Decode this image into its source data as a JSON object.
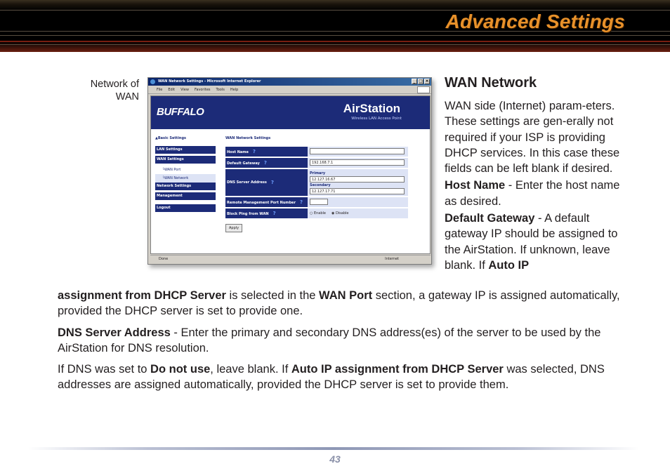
{
  "header": {
    "title": "Advanced Settings"
  },
  "figure": {
    "caption": "Network of WAN",
    "window_title": "WAN Network Settings - Microsoft Internet Explorer",
    "menu": [
      "File",
      "Edit",
      "View",
      "Favorites",
      "Tools",
      "Help"
    ],
    "brand": "BUFFALO",
    "product": "AirStation",
    "product_sub": "Wireless LAN Access Point",
    "nav_basic": "▲Basic Settings",
    "nav": {
      "lan": "LAN Settings",
      "wan": "WAN Settings",
      "wan_port": "└WAN Port",
      "wan_network": "└WAN Network",
      "network": "Network Settings",
      "management": "Management",
      "logout": "Logout"
    },
    "content_title": "WAN Network Settings",
    "fields": {
      "host_name": "Host Name",
      "default_gateway": "Default Gateway",
      "gateway_value": "192.168.7.1",
      "dns": "DNS Server Address",
      "primary": "Primary",
      "primary_value": "12.127.16.67",
      "secondary": "Secondary",
      "secondary_value": "12.127.17.71",
      "remote_port": "Remote Management Port Number",
      "block_ping": "Block Ping from WAN",
      "enable": "Enable",
      "disable": "Disable",
      "q": "?"
    },
    "apply": "Apply",
    "status_done": "Done",
    "status_zone": "Internet"
  },
  "section_title": "WAN Network",
  "rcol": {
    "p1": "WAN side (Internet) param-eters.  These settings are gen-erally not required if your ISP is providing DHCP services.  In this case these fields can be left blank if desired.",
    "host_bold": "Host Name",
    "host_text": " - Enter the host name as desired.",
    "gw_bold": "Default Gateway",
    "gw_text": "  - A default gateway IP should be assigned to the AirStation.  If unknown, leave blank.  If ",
    "gw_bold2": "Auto IP"
  },
  "full": {
    "gw_cont_bold": "assignment from DHCP Server",
    "gw_cont_a": " is selected in the ",
    "gw_cont_bold2": "WAN Port",
    "gw_cont_b": " section, a gateway IP is assigned automatically, provided the DHCP server is set to provide one.",
    "dns_bold": "DNS Server Address",
    "dns_text": " - Enter the primary and secondary DNS address(es) of the server to be used by the AirStation for DNS resolution.",
    "last_a": "If DNS was set to ",
    "last_bold": "Do not use",
    "last_b": ", leave blank.  If ",
    "last_bold2": "Auto IP assignment from DHCP Server",
    "last_c": " was selected, DNS addresses are assigned automatically, provided the DHCP server is set to provide them."
  },
  "page_number": "43"
}
